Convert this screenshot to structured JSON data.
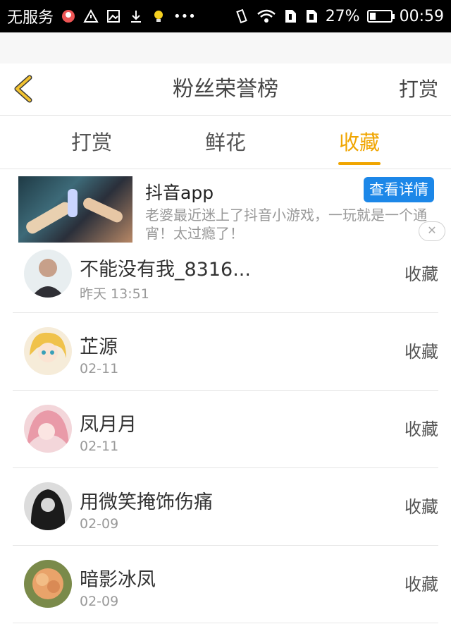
{
  "status_bar": {
    "carrier": "无服务",
    "battery_text": "27%",
    "battery_level": 0.27,
    "time": "00:59",
    "icons": [
      "app-icon",
      "alert-icon",
      "image-icon",
      "download-icon",
      "bulb-icon",
      "more-icon",
      "vibrate-icon",
      "wifi-icon",
      "sim1-icon",
      "sim2-icon"
    ]
  },
  "header": {
    "back_icon": "chevron-left-icon",
    "title": "粉丝荣誉榜",
    "right_label": "打赏"
  },
  "tabs": [
    {
      "label": "打赏",
      "active": false
    },
    {
      "label": "鲜花",
      "active": false
    },
    {
      "label": "收藏",
      "active": true
    }
  ],
  "ad": {
    "title": "抖音app",
    "button": "查看详情",
    "description": "老婆最近迷上了抖音小游戏，一玩就是一个通宵！太过瘾了！",
    "close_icon": "close-icon"
  },
  "list": [
    {
      "name": "不能没有我_8316...",
      "date": "昨天 13:51",
      "action": "收藏"
    },
    {
      "name": "芷源",
      "date": "02-11",
      "action": "收藏"
    },
    {
      "name": "凤月月",
      "date": "02-11",
      "action": "收藏"
    },
    {
      "name": "用微笑掩饰伤痛",
      "date": "02-09",
      "action": "收藏"
    },
    {
      "name": "暗影冰凤",
      "date": "02-09",
      "action": "收藏"
    }
  ],
  "colors": {
    "accent": "#f0a500",
    "ad_button": "#1c87e8",
    "status_bar": "#000000"
  }
}
